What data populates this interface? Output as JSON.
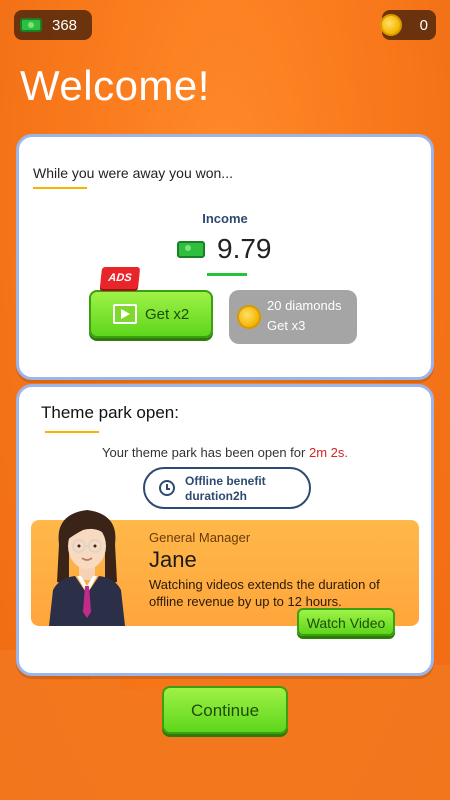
{
  "hud": {
    "money": "368",
    "coins": "0"
  },
  "title": "Welcome!",
  "away_card": {
    "intro": "While you were away you won...",
    "income_label": "Income",
    "income_value": "9.79",
    "double_button": "Get x2",
    "ads_badge": "ADS",
    "diamond_line1": "20 diamonds",
    "diamond_line2": "Get x3"
  },
  "park_card": {
    "title": "Theme park open:",
    "open_text": "Your theme park has been open for ",
    "open_duration": "2m 2s.",
    "offline_line1": "Offline benefit",
    "offline_line2": "duration2h",
    "manager_role": "General Manager",
    "manager_name": "Jane",
    "manager_desc": "Watching videos extends the duration of offline revenue by up to 12 hours.",
    "watch_button": "Watch Video"
  },
  "continue_button": "Continue",
  "colors": {
    "background": "#f97a1c",
    "card_border": "#9bb4ea",
    "button_green": "#5ed61c",
    "highlight_red": "#d42424"
  }
}
